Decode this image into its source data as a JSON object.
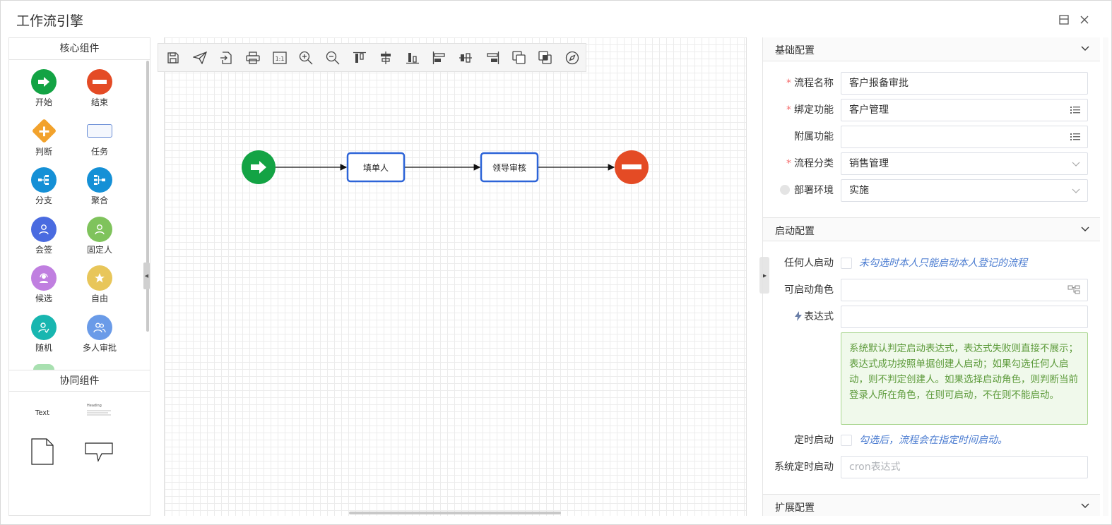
{
  "window": {
    "title": "工作流引擎"
  },
  "left_panel": {
    "core_header": "核心组件",
    "core_items": [
      {
        "label": "开始",
        "icon": "arrow-right-icon",
        "color": "#13a344"
      },
      {
        "label": "结束",
        "icon": "minus-icon",
        "color": "#e44b25"
      },
      {
        "label": "判断",
        "icon": "plus-diamond-icon",
        "color": "#f2a22c"
      },
      {
        "label": "任务",
        "icon": "task-rect-icon",
        "color": "#6b8fd6"
      },
      {
        "label": "分支",
        "icon": "branch-icon",
        "color": "#1590d6"
      },
      {
        "label": "聚合",
        "icon": "merge-icon",
        "color": "#1590d6"
      },
      {
        "label": "会签",
        "icon": "user-icon",
        "color": "#4a6be0"
      },
      {
        "label": "固定人",
        "icon": "user-icon",
        "color": "#7fc35c"
      },
      {
        "label": "候选",
        "icon": "headset-user-icon",
        "color": "#c07fe0"
      },
      {
        "label": "自由",
        "icon": "star-icon",
        "color": "#e8c65a"
      },
      {
        "label": "随机",
        "icon": "user-random-icon",
        "color": "#18b6b0"
      },
      {
        "label": "多人审批",
        "icon": "users-icon",
        "color": "#6a9be8"
      }
    ],
    "collab_header": "协同组件",
    "collab_items": [
      {
        "label": "Text",
        "name": "text-shape"
      },
      {
        "label": "Heading",
        "name": "heading-shape"
      },
      {
        "label": "",
        "name": "document-shape"
      },
      {
        "label": "",
        "name": "callout-shape"
      }
    ]
  },
  "toolbar": {
    "items": [
      "save-icon",
      "send-icon",
      "export-icon",
      "print-icon",
      "actual-size-icon",
      "zoom-in-icon",
      "zoom-out-icon",
      "align-top-icon",
      "align-middle-icon",
      "align-bottom-icon",
      "align-left-icon",
      "align-center-icon",
      "align-right-icon",
      "bring-front-icon",
      "send-back-icon",
      "navigator-icon"
    ],
    "actual_size_label": "1:1"
  },
  "diagram": {
    "nodes": [
      {
        "id": "start",
        "type": "start",
        "label": ""
      },
      {
        "id": "filler",
        "type": "task",
        "label": "填单人"
      },
      {
        "id": "leader",
        "type": "task",
        "label": "领导审核"
      },
      {
        "id": "end",
        "type": "end",
        "label": ""
      }
    ],
    "edges": [
      [
        "start",
        "filler"
      ],
      [
        "filler",
        "leader"
      ],
      [
        "leader",
        "end"
      ]
    ]
  },
  "right_panel": {
    "basic": {
      "title": "基础配置",
      "flow_name": {
        "label": "流程名称",
        "value": "客户报备审批"
      },
      "bind_func": {
        "label": "绑定功能",
        "value": "客户管理"
      },
      "attach_func": {
        "label": "附属功能",
        "value": ""
      },
      "category": {
        "label": "流程分类",
        "value": "销售管理"
      },
      "env": {
        "label": "部署环境",
        "value": "实施"
      }
    },
    "startup": {
      "title": "启动配置",
      "anyone": {
        "label": "任何人启动",
        "hint": "未勾选时本人只能启动本人登记的流程"
      },
      "roles": {
        "label": "可启动角色",
        "value": ""
      },
      "expr": {
        "label": "表达式",
        "value": ""
      },
      "note": "系统默认判定启动表达式，表达式失败则直接不展示；表达式成功按照单据创建人启动；如果勾选任何人启动，则不判定创建人。如果选择启动角色，则判断当前登录人所在角色，在则可启动，不在则不能启动。",
      "timed": {
        "label": "定时启动",
        "hint": "勾选后，流程会在指定时间启动。"
      },
      "cron": {
        "label": "系统定时启动",
        "placeholder": "cron表达式"
      }
    },
    "ext": {
      "title": "扩展配置"
    }
  }
}
